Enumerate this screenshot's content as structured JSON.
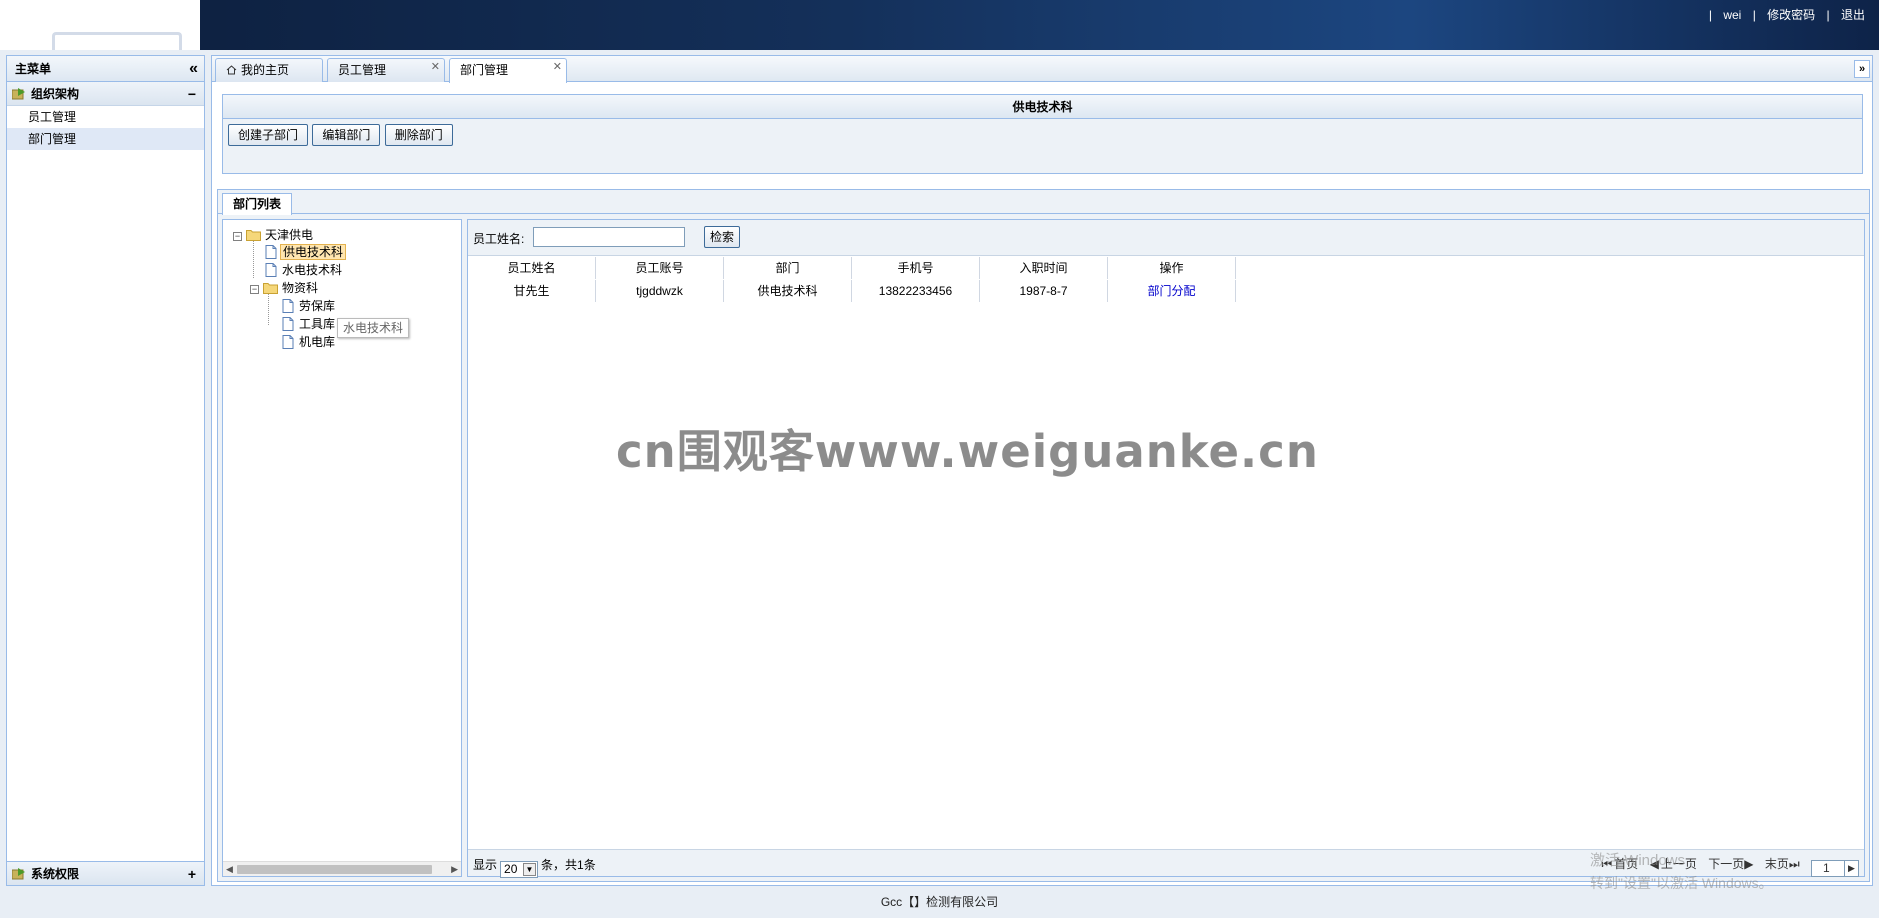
{
  "header": {
    "user": "wei",
    "change_password": "修改密码",
    "logout": "退出",
    "separator": "|"
  },
  "sidebar": {
    "title": "主菜单",
    "groups": [
      {
        "label": "组织架构",
        "toggle": "−",
        "items": [
          {
            "label": "员工管理"
          },
          {
            "label": "部门管理",
            "active": true
          }
        ]
      },
      {
        "label": "系统权限",
        "toggle": "+"
      }
    ]
  },
  "tabs": [
    {
      "label": "我的主页",
      "closable": false,
      "icon": "home-icon"
    },
    {
      "label": "员工管理",
      "closable": true
    },
    {
      "label": "部门管理",
      "closable": true,
      "active": true
    }
  ],
  "dept_panel": {
    "title": "供电技术科",
    "buttons": [
      "创建子部门",
      "编辑部门",
      "删除部门"
    ]
  },
  "list_panel": {
    "tab": "部门列表"
  },
  "tree": {
    "root": "天津供电",
    "nodes": [
      {
        "label": "供电技术科",
        "selected": true
      },
      {
        "label": "水电技术科"
      },
      {
        "label": "物资科",
        "children": [
          "劳保库",
          "工具库",
          "机电库"
        ]
      }
    ],
    "tooltip": "水电技术科"
  },
  "search": {
    "label": "员工姓名:",
    "value": "",
    "button": "检索"
  },
  "grid": {
    "columns": [
      "员工姓名",
      "员工账号",
      "部门",
      "手机号",
      "入职时间",
      "操作"
    ],
    "rows": [
      {
        "name": "甘先生",
        "account": "tjgddwzk",
        "dept": "供电技术科",
        "phone": "13822233456",
        "joined": "1987-8-7",
        "action": "部门分配"
      }
    ]
  },
  "pager": {
    "show": "显示",
    "page_size": "20",
    "summary": "条，共1条",
    "first": "首页",
    "prev": "上一页",
    "next": "下一页",
    "last": "末页",
    "page": "1"
  },
  "watermark": "cn围观客www.weiguanke.cn",
  "os_notice": {
    "line1": "激活 Windows",
    "line2": "转到\"设置\"以激活 Windows。"
  },
  "footer": "Gcc【】检测有限公司",
  "colors": {
    "header_bg": "#14305a",
    "border": "#99bbe8",
    "link": "#0000cc",
    "selected_node": "#ffe6b0"
  }
}
